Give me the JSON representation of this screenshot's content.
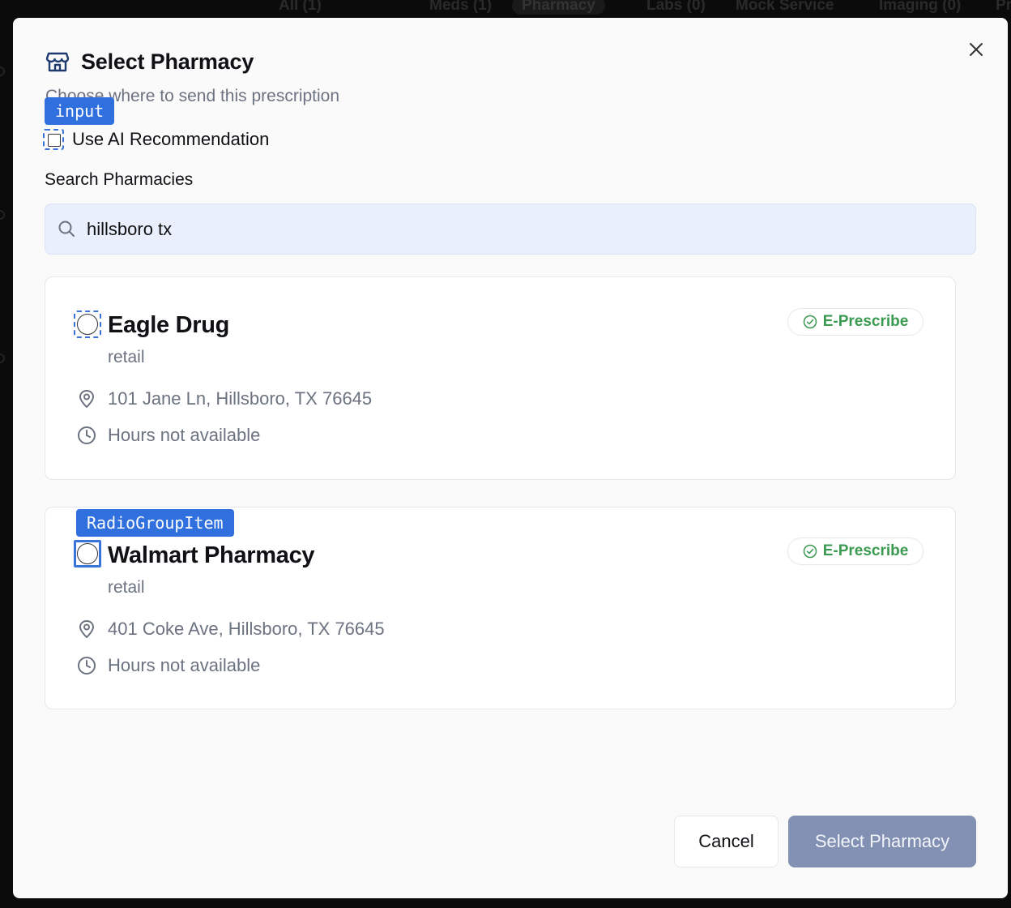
{
  "background_tabs": [
    {
      "label": "All (1)"
    },
    {
      "label": "Meds (1)"
    },
    {
      "label": "Pharmacy"
    },
    {
      "label": "Labs (0)"
    },
    {
      "label": "Mock Service"
    },
    {
      "label": "Imaging (0)"
    },
    {
      "label": "Pr"
    }
  ],
  "dialog": {
    "title": "Select Pharmacy",
    "subtitle": "Choose where to send this prescription",
    "title_icon": "store-icon",
    "close_icon": "close-icon"
  },
  "ai_recommendation": {
    "label": "Use AI Recommendation",
    "checked": false
  },
  "search": {
    "label": "Search Pharmacies",
    "value": "hillsboro tx",
    "icon": "search-icon"
  },
  "overlay_tags": {
    "input": "input",
    "radio": "RadioGroupItem"
  },
  "pharmacies": [
    {
      "name": "Eagle Drug",
      "type": "retail",
      "address": "101 Jane Ln, Hillsboro, TX 76645",
      "hours": "Hours not available",
      "badge": "E-Prescribe",
      "selected": false
    },
    {
      "name": "Walmart Pharmacy",
      "type": "retail",
      "address": "401 Coke Ave, Hillsboro, TX 76645",
      "hours": "Hours not available",
      "badge": "E-Prescribe",
      "selected": false
    }
  ],
  "footer": {
    "cancel_label": "Cancel",
    "select_label": "Select Pharmacy"
  },
  "colors": {
    "accent": "#2f6fde",
    "badge_green": "#3a9a4f",
    "primary_disabled": "#8290b3",
    "search_bg": "#e9effd"
  }
}
